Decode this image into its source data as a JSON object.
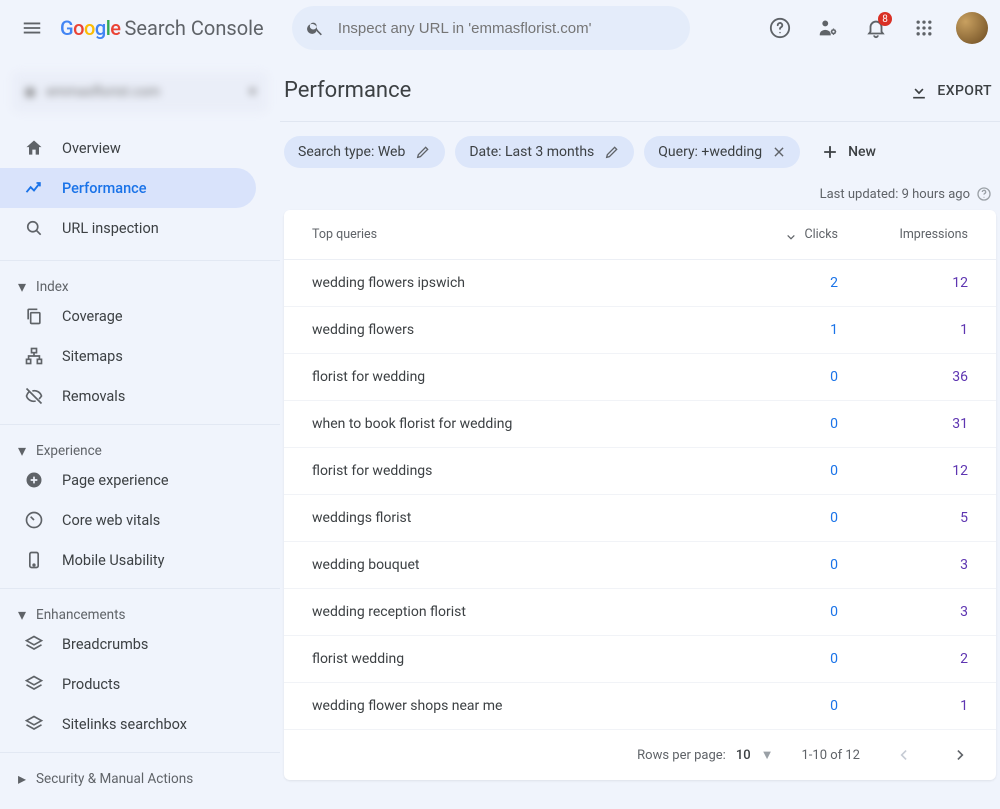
{
  "header": {
    "product": "Search Console",
    "search_placeholder": "Inspect any URL in 'emmasflorist.com'",
    "notif_count": "8"
  },
  "sidebar": {
    "property": "emmasflorist.com",
    "items_top": [
      {
        "label": "Overview"
      },
      {
        "label": "Performance"
      },
      {
        "label": "URL inspection"
      }
    ],
    "group_index": "Index",
    "items_index": [
      {
        "label": "Coverage"
      },
      {
        "label": "Sitemaps"
      },
      {
        "label": "Removals"
      }
    ],
    "group_experience": "Experience",
    "items_experience": [
      {
        "label": "Page experience"
      },
      {
        "label": "Core web vitals"
      },
      {
        "label": "Mobile Usability"
      }
    ],
    "group_enhancements": "Enhancements",
    "items_enhancements": [
      {
        "label": "Breadcrumbs"
      },
      {
        "label": "Products"
      },
      {
        "label": "Sitelinks searchbox"
      }
    ],
    "group_security": "Security & Manual Actions"
  },
  "main": {
    "title": "Performance",
    "export": "EXPORT",
    "chips": {
      "type": "Search type: Web",
      "date": "Date: Last 3 months",
      "query": "Query: +wedding",
      "new": "New"
    },
    "updated": "Last updated: 9 hours ago"
  },
  "table": {
    "head_q": "Top queries",
    "head_c": "Clicks",
    "head_i": "Impressions",
    "rows": [
      {
        "q": "wedding flowers ipswich",
        "c": "2",
        "i": "12"
      },
      {
        "q": "wedding flowers",
        "c": "1",
        "i": "1"
      },
      {
        "q": "florist for wedding",
        "c": "0",
        "i": "36"
      },
      {
        "q": "when to book florist for wedding",
        "c": "0",
        "i": "31"
      },
      {
        "q": "florist for weddings",
        "c": "0",
        "i": "12"
      },
      {
        "q": "weddings florist",
        "c": "0",
        "i": "5"
      },
      {
        "q": "wedding bouquet",
        "c": "0",
        "i": "3"
      },
      {
        "q": "wedding reception florist",
        "c": "0",
        "i": "3"
      },
      {
        "q": "florist wedding",
        "c": "0",
        "i": "2"
      },
      {
        "q": "wedding flower shops near me",
        "c": "0",
        "i": "1"
      }
    ],
    "footer": {
      "rpp_label": "Rows per page:",
      "rpp_value": "10",
      "range": "1-10 of 12"
    }
  }
}
